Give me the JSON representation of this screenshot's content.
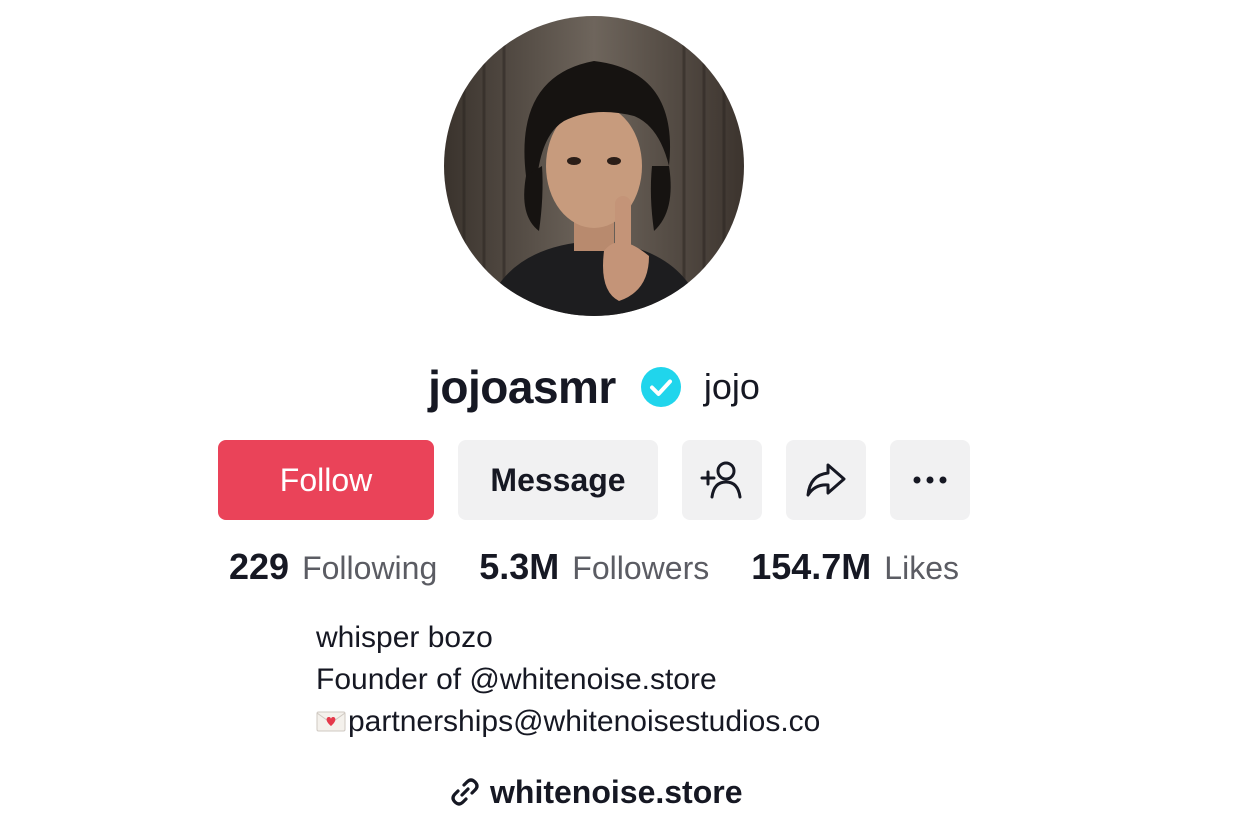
{
  "profile": {
    "username": "jojoasmr",
    "nickname": "jojo",
    "verified": true,
    "avatar": "avatar-image"
  },
  "actions": {
    "follow_label": "Follow",
    "message_label": "Message",
    "add_friend_icon": "person-plus-icon",
    "share_icon": "share-arrow-icon",
    "more_icon": "more-dots-icon"
  },
  "stats": {
    "following_count": "229",
    "following_label": "Following",
    "followers_count": "5.3M",
    "followers_label": "Followers",
    "likes_count": "154.7M",
    "likes_label": "Likes"
  },
  "bio": {
    "line1": "whisper bozo",
    "line2": "Founder of @whitenoise.store",
    "line3": "partnerships@whitenoisestudios.co",
    "line3_icon": "love-letter-icon"
  },
  "link": {
    "icon": "link-icon",
    "text": "whitenoise.store"
  },
  "colors": {
    "follow_button": "#ea4359",
    "secondary_button": "#f1f1f2",
    "verified_badge": "#20d5ec",
    "text_primary": "#161823",
    "text_secondary": "#5b5c63"
  }
}
